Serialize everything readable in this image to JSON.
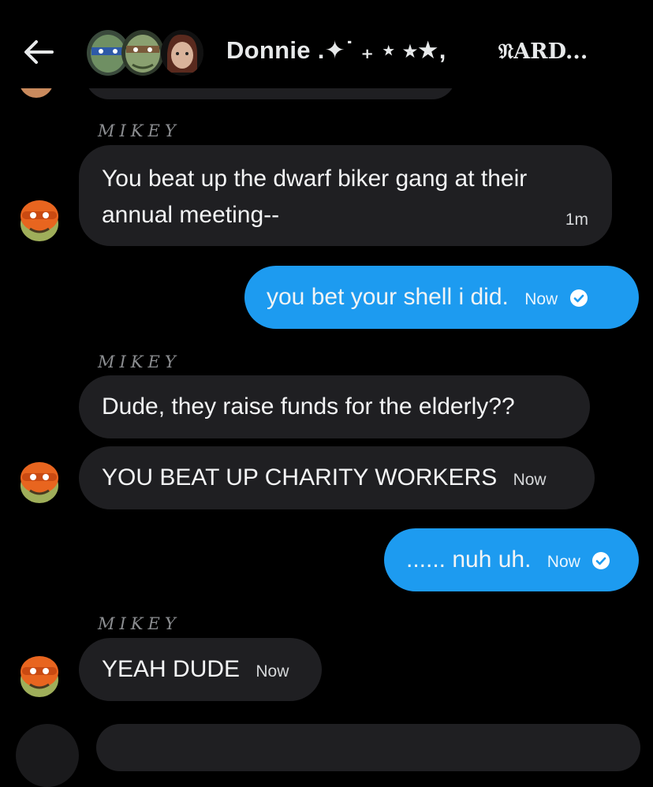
{
  "header": {
    "back_icon": "arrow-left-icon",
    "title": "Donnie .✦˙ ₊ ⋆ ⭒★,",
    "subtitle": "𝔑ARD..."
  },
  "messages": [
    {
      "sender": "MIKEY",
      "text_line1": "You beat up the dwarf biker gang at their",
      "text_line2": "annual meeting--",
      "time": "1m"
    },
    {
      "text": "you bet your shell i did.",
      "time": "Now"
    },
    {
      "sender": "MIKEY",
      "text": "Dude, they raise funds for the elderly??"
    },
    {
      "text": "YOU BEAT UP CHARITY WORKERS",
      "time": "Now"
    },
    {
      "text": "...... nuh uh.",
      "time": "Now"
    },
    {
      "sender": "MIKEY",
      "text": "YEAH DUDE",
      "time": "Now"
    }
  ],
  "colors": {
    "background": "#000000",
    "incoming_bubble": "#1f1f22",
    "outgoing_bubble": "#1d9bf0",
    "sender_label": "#8b8d90"
  }
}
